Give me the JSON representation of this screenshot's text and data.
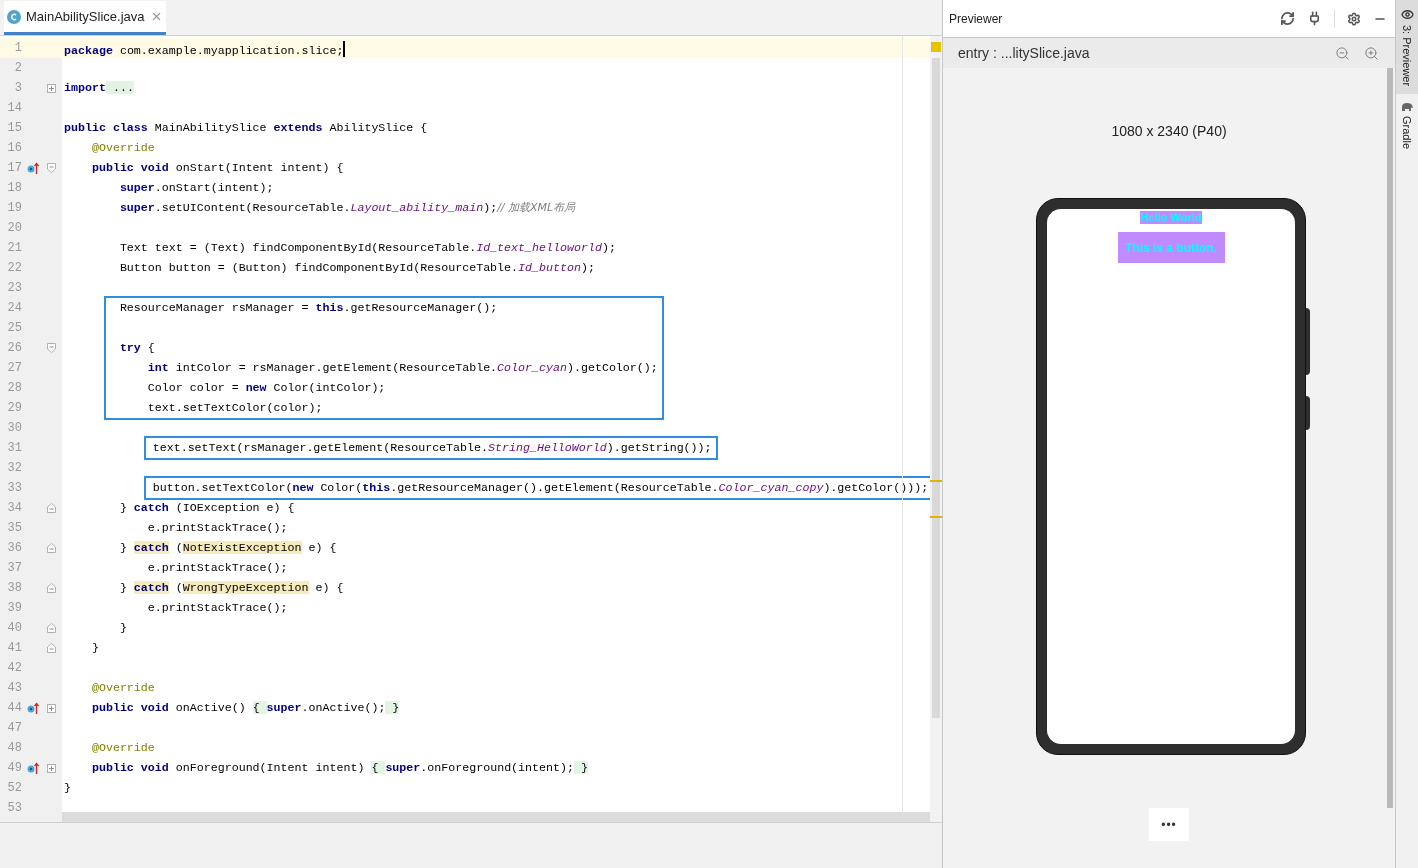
{
  "tab": {
    "label": "MainAbilitySlice.java",
    "selected": true
  },
  "editor": {
    "blocks": [
      {
        "boxed": false,
        "lines": [
          {
            "n": "1",
            "current": true,
            "segs": [
              {
                "text": "package",
                "kind": "kw"
              },
              {
                "text": " com.example.myapplication.slice;",
                "kind": "plain"
              }
            ]
          },
          {
            "n": "2",
            "current": false
          },
          {
            "n": "3",
            "current": false,
            "gutter": [
              {
                "kind": "fold-collapsed"
              }
            ],
            "segs": [
              {
                "text": "import",
                "kind": "kw"
              },
              {
                "text": " ...",
                "kind": "fold"
              }
            ]
          },
          {
            "n": "14",
            "current": false
          },
          {
            "n": "15",
            "current": false,
            "segs": [
              {
                "text": "public class",
                "kind": "kw"
              },
              {
                "text": " MainAbilitySlice ",
                "kind": "plain"
              },
              {
                "text": "extends",
                "kind": "kw"
              },
              {
                "text": " AbilitySlice {",
                "kind": "plain"
              }
            ]
          },
          {
            "n": "16",
            "current": false,
            "segs": [
              {
                "text": "    @Override",
                "kind": "ann"
              }
            ]
          },
          {
            "n": "17",
            "current": false,
            "gutter": [
              {
                "kind": "override"
              },
              {
                "kind": "fold-open"
              }
            ],
            "segs": [
              {
                "text": "    public void",
                "kind": "kw"
              },
              {
                "text": " onStart(Intent intent) {",
                "kind": "plain"
              }
            ]
          },
          {
            "n": "18",
            "current": false,
            "segs": [
              {
                "text": "        super",
                "kind": "kw"
              },
              {
                "text": ".onStart(intent);",
                "kind": "plain"
              }
            ]
          },
          {
            "n": "19",
            "current": false,
            "segs": [
              {
                "text": "        super",
                "kind": "kw"
              },
              {
                "text": ".setUIContent(ResourceTable.",
                "kind": "plain"
              },
              {
                "text": "Layout_ability_main",
                "kind": "const"
              },
              {
                "text": ");",
                "kind": "plain"
              },
              {
                "text": "// 加载XML布局",
                "kind": "cmt"
              }
            ]
          },
          {
            "n": "20",
            "current": false
          },
          {
            "n": "21",
            "current": false,
            "segs": [
              {
                "text": "        Text text = (Text) findComponentById(ResourceTable.",
                "kind": "plain"
              },
              {
                "text": "Id_text_helloworld",
                "kind": "const"
              },
              {
                "text": ");",
                "kind": "plain"
              }
            ]
          },
          {
            "n": "22",
            "current": false,
            "segs": [
              {
                "text": "        Button button = (Button) findComponentById(ResourceTable.",
                "kind": "plain"
              },
              {
                "text": "Id_button",
                "kind": "const"
              },
              {
                "text": ");",
                "kind": "plain"
              }
            ]
          },
          {
            "n": "23",
            "current": false
          }
        ]
      },
      {
        "boxed": true,
        "lines": [
          {
            "n": "24",
            "current": false,
            "segs": [
              {
                "text": "        ResourceManager rsManager = ",
                "kind": "plain"
              },
              {
                "text": "this",
                "kind": "kw"
              },
              {
                "text": ".getResourceManager();",
                "kind": "plain"
              }
            ]
          },
          {
            "n": "25",
            "current": false
          },
          {
            "n": "26",
            "current": false,
            "gutter": [
              {
                "kind": "fold-open"
              }
            ],
            "segs": [
              {
                "text": "        try",
                "kind": "kw"
              },
              {
                "text": " {",
                "kind": "plain"
              }
            ]
          },
          {
            "n": "27",
            "current": false,
            "segs": [
              {
                "text": "            int",
                "kind": "kw"
              },
              {
                "text": " intColor = rsManager.getElement(ResourceTable.",
                "kind": "plain"
              },
              {
                "text": "Color_cyan",
                "kind": "const"
              },
              {
                "text": ").getColor();",
                "kind": "plain"
              }
            ]
          },
          {
            "n": "28",
            "current": false,
            "segs": [
              {
                "text": "            Color color = ",
                "kind": "plain"
              },
              {
                "text": "new",
                "kind": "kw"
              },
              {
                "text": " Color(intColor);",
                "kind": "plain"
              }
            ]
          },
          {
            "n": "29",
            "current": false,
            "segs": [
              {
                "text": "            text.setTextColor(color);",
                "kind": "plain"
              }
            ]
          }
        ]
      },
      {
        "boxed": false,
        "lines": [
          {
            "n": "30",
            "current": false
          }
        ]
      },
      {
        "boxed": true,
        "lines": [
          {
            "n": "31",
            "current": false,
            "segs": [
              {
                "text": "            text.setText(rsManager.getElement(ResourceTable.",
                "kind": "plain"
              },
              {
                "text": "String_HelloWorld",
                "kind": "const"
              },
              {
                "text": ").getString());",
                "kind": "plain"
              }
            ]
          }
        ]
      },
      {
        "boxed": false,
        "lines": [
          {
            "n": "32",
            "current": false
          }
        ]
      },
      {
        "boxed": true,
        "lines": [
          {
            "n": "33",
            "current": false,
            "segs": [
              {
                "text": "            button.setTextColor(",
                "kind": "plain"
              },
              {
                "text": "new",
                "kind": "kw"
              },
              {
                "text": " Color(",
                "kind": "plain"
              },
              {
                "text": "this",
                "kind": "kw"
              },
              {
                "text": ".getResourceManager().getElement(ResourceTable.",
                "kind": "plain"
              },
              {
                "text": "Color_cyan_copy",
                "kind": "const"
              },
              {
                "text": ").getColor()));",
                "kind": "plain"
              }
            ]
          }
        ]
      },
      {
        "boxed": false,
        "lines": [
          {
            "n": "34",
            "current": false,
            "gutter": [
              {
                "kind": "fold-end"
              }
            ],
            "segs": [
              {
                "text": "        } ",
                "kind": "plain"
              },
              {
                "text": "catch",
                "kind": "kw"
              },
              {
                "text": " (IOException e) {",
                "kind": "plain"
              }
            ]
          },
          {
            "n": "35",
            "current": false,
            "segs": [
              {
                "text": "            e.printStackTrace();",
                "kind": "plain"
              }
            ]
          },
          {
            "n": "36",
            "current": false,
            "gutter": [
              {
                "kind": "fold-end"
              }
            ],
            "segs": [
              {
                "text": "        } ",
                "kind": "plain"
              },
              {
                "text": "catch",
                "kind": "kwwarn"
              },
              {
                "text": " (",
                "kind": "plain"
              },
              {
                "text": "NotExistException",
                "kind": "warn"
              },
              {
                "text": " e) {",
                "kind": "plain"
              }
            ]
          },
          {
            "n": "37",
            "current": false,
            "segs": [
              {
                "text": "            e.printStackTrace();",
                "kind": "plain"
              }
            ]
          },
          {
            "n": "38",
            "current": false,
            "gutter": [
              {
                "kind": "fold-end"
              }
            ],
            "segs": [
              {
                "text": "        } ",
                "kind": "plain"
              },
              {
                "text": "catch",
                "kind": "kwwarn"
              },
              {
                "text": " (",
                "kind": "plain"
              },
              {
                "text": "WrongTypeException",
                "kind": "warn"
              },
              {
                "text": " e) {",
                "kind": "plain"
              }
            ]
          },
          {
            "n": "39",
            "current": false,
            "segs": [
              {
                "text": "            e.printStackTrace();",
                "kind": "plain"
              }
            ]
          },
          {
            "n": "40",
            "current": false,
            "gutter": [
              {
                "kind": "fold-end"
              }
            ],
            "segs": [
              {
                "text": "        }",
                "kind": "plain"
              }
            ]
          },
          {
            "n": "41",
            "current": false,
            "gutter": [
              {
                "kind": "fold-end"
              }
            ],
            "segs": [
              {
                "text": "    }",
                "kind": "plain"
              }
            ]
          },
          {
            "n": "42",
            "current": false
          },
          {
            "n": "43",
            "current": false,
            "segs": [
              {
                "text": "    @Override",
                "kind": "ann"
              }
            ]
          },
          {
            "n": "44",
            "current": false,
            "gutter": [
              {
                "kind": "override"
              },
              {
                "kind": "fold-collapsed"
              }
            ],
            "segs": [
              {
                "text": "    public void",
                "kind": "kw"
              },
              {
                "text": " onActive() ",
                "kind": "plain"
              },
              {
                "text": "{ ",
                "kind": "fold"
              },
              {
                "text": "super",
                "kind": "kw"
              },
              {
                "text": ".onActive();",
                "kind": "plain"
              },
              {
                "text": " }",
                "kind": "fold"
              }
            ]
          },
          {
            "n": "47",
            "current": false
          },
          {
            "n": "48",
            "current": false,
            "segs": [
              {
                "text": "    @Override",
                "kind": "ann"
              }
            ]
          },
          {
            "n": "49",
            "current": false,
            "gutter": [
              {
                "kind": "override"
              },
              {
                "kind": "fold-collapsed"
              }
            ],
            "segs": [
              {
                "text": "    public void",
                "kind": "kw"
              },
              {
                "text": " onForeground(Intent intent) ",
                "kind": "plain"
              },
              {
                "text": "{ ",
                "kind": "fold"
              },
              {
                "text": "super",
                "kind": "kw"
              },
              {
                "text": ".onForeground(intent);",
                "kind": "plain"
              },
              {
                "text": " }",
                "kind": "fold"
              }
            ]
          },
          {
            "n": "52",
            "current": false,
            "segs": [
              {
                "text": "}",
                "kind": "plain"
              }
            ]
          },
          {
            "n": "53",
            "current": false
          }
        ]
      }
    ]
  },
  "previewer": {
    "title": "Previewer",
    "entry": "entry : ...litySlice.java",
    "device": "1080 x 2340 (P40)",
    "screen": {
      "text": "Hello World",
      "button": "This is a button."
    },
    "more_button": "•••"
  },
  "side_tabs": [
    {
      "label": "3: Previewer",
      "selected": true
    },
    {
      "label": "Gradle",
      "selected": false
    }
  ]
}
